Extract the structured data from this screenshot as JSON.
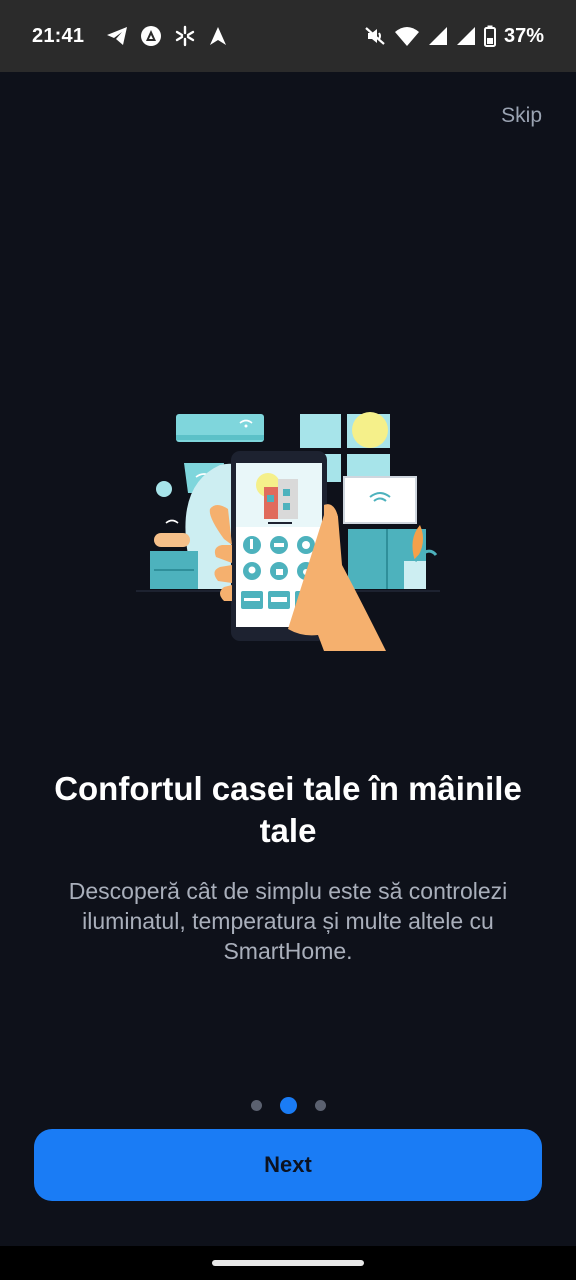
{
  "status_bar": {
    "time": "21:41",
    "left_icons": [
      "telegram-icon",
      "vpn-icon",
      "pinwheel-icon",
      "arrow-app-icon"
    ],
    "right_icons": [
      "mute-icon",
      "wifi-icon",
      "signal-icon",
      "signal-icon",
      "battery-icon"
    ],
    "battery": "37%"
  },
  "onboarding": {
    "skip_label": "Skip",
    "title": "Confortul casei tale în mâinile tale",
    "subtitle": "Descoperă cât de simplu este să controlezi iluminatul, temperatura și multe altele cu SmartHome.",
    "illustration": "smart-home-phone-illustration",
    "pagination": {
      "total": 3,
      "current": 2
    },
    "next_label": "Next"
  },
  "colors": {
    "background": "#0e111a",
    "status_bar": "#2b2b2b",
    "accent": "#1a7cf5",
    "subtitle": "#a9afbb",
    "skip": "#9aa3b2"
  }
}
